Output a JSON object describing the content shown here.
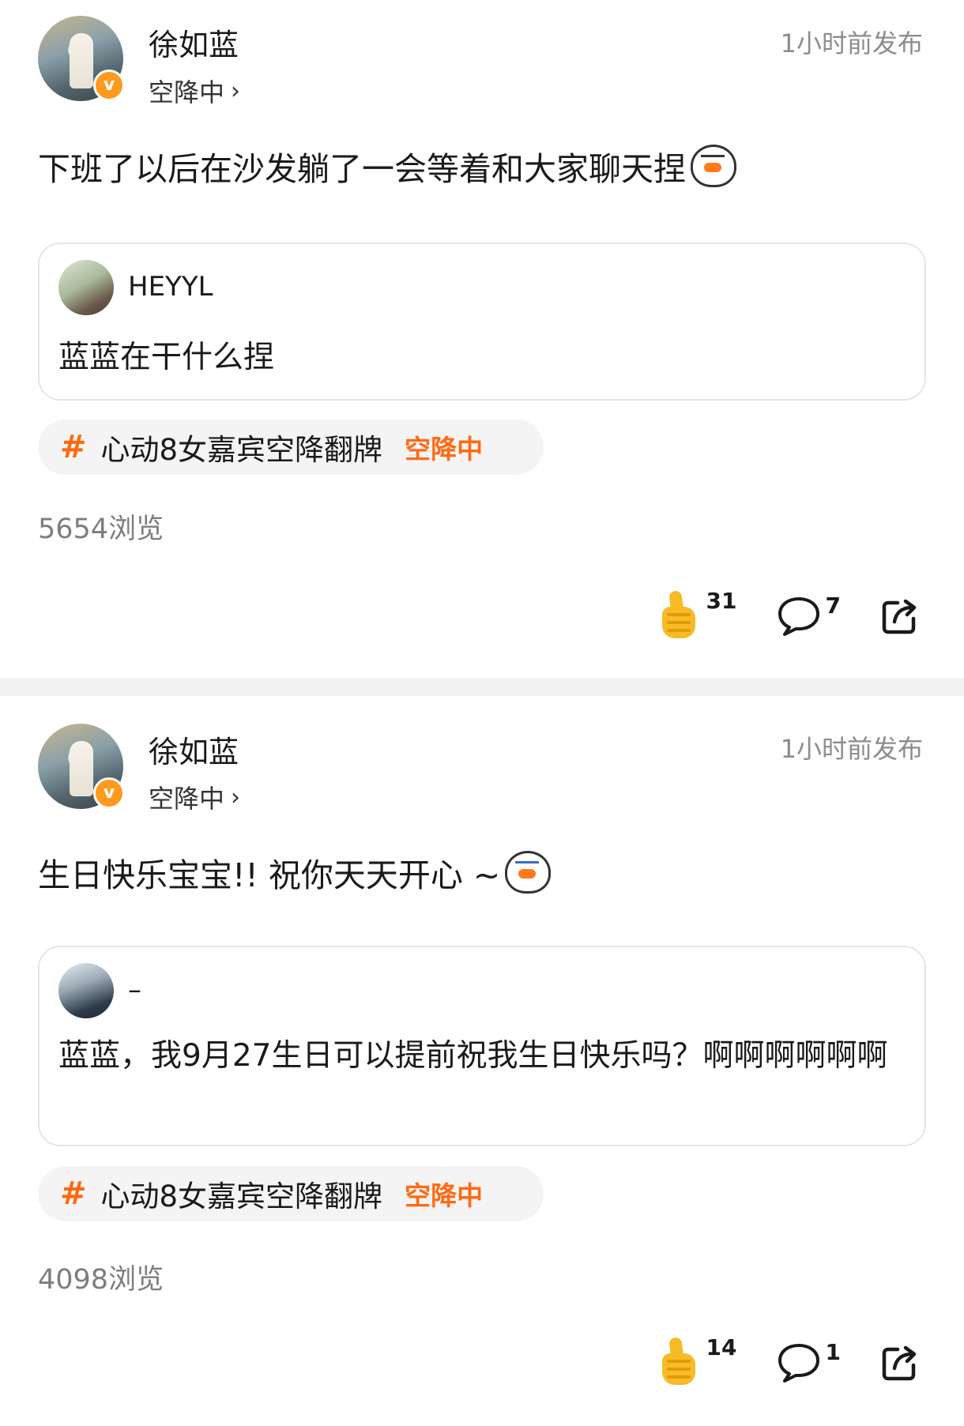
{
  "posts": [
    {
      "author": "徐如蓝",
      "status": "空降中",
      "time": "1小时前发布",
      "text": "下班了以后在沙发躺了一会等着和大家聊天捏",
      "quote": {
        "user": "HEYYL",
        "text": "蓝蓝在干什么捏"
      },
      "topic": {
        "hash": "#",
        "name": "心动8女嘉宾空降翻牌",
        "status": "空降中"
      },
      "views": "5654浏览",
      "likes": "31",
      "comments": "7"
    },
    {
      "author": "徐如蓝",
      "status": "空降中",
      "time": "1小时前发布",
      "text": "生日快乐宝宝!! 祝你天天开心 ~",
      "quote": {
        "user": "–",
        "text": "蓝蓝，我9月27生日可以提前祝我生日快乐吗？啊啊啊啊啊啊"
      },
      "topic": {
        "hash": "#",
        "name": "心动8女嘉宾空降翻牌",
        "status": "空降中"
      },
      "views": "4098浏览",
      "likes": "14",
      "comments": "1"
    }
  ],
  "colors": {
    "accent": "#ff6a13",
    "like": "#f7bb26",
    "badge": "#ff9a1f"
  },
  "icons": {
    "verified": "v-badge-icon",
    "like": "thumbs-up-icon",
    "comment": "comment-bubble-icon",
    "share": "share-icon",
    "chevron": "chevron-right-icon"
  }
}
